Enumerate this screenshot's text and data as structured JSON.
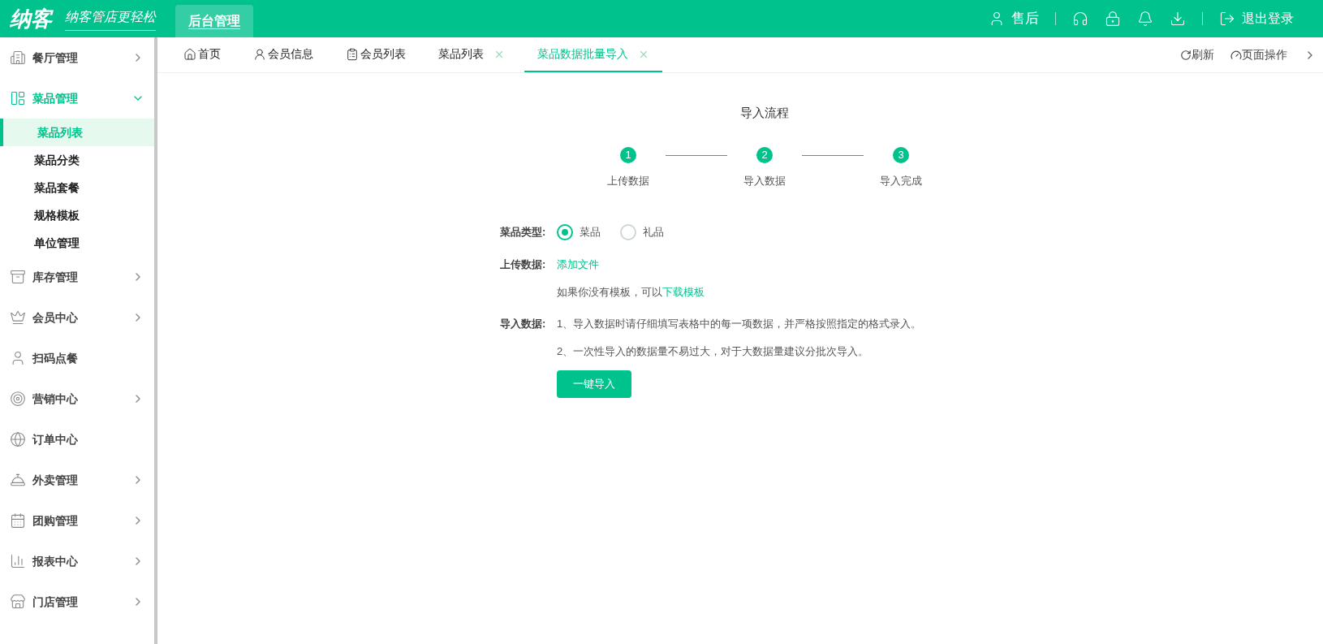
{
  "header": {
    "logo": "纳客",
    "slogan": "纳客管店更轻松",
    "nav_tab": "后台管理",
    "service": "售后",
    "logout": "退出登录"
  },
  "sidebar": {
    "items": [
      {
        "label": "餐厅管理",
        "expanded": false,
        "has_arrow": true
      },
      {
        "label": "菜品管理",
        "expanded": true,
        "has_arrow": true,
        "children": [
          {
            "label": "菜品列表",
            "selected": true
          },
          {
            "label": "菜品分类",
            "selected": false
          },
          {
            "label": "菜品套餐",
            "selected": false
          },
          {
            "label": "规格模板",
            "selected": false
          },
          {
            "label": "单位管理",
            "selected": false
          }
        ]
      },
      {
        "label": "库存管理",
        "expanded": false,
        "has_arrow": true
      },
      {
        "label": "会员中心",
        "expanded": false,
        "has_arrow": true
      },
      {
        "label": "扫码点餐",
        "expanded": false,
        "has_arrow": false
      },
      {
        "label": "营销中心",
        "expanded": false,
        "has_arrow": true
      },
      {
        "label": "订单中心",
        "expanded": false,
        "has_arrow": false
      },
      {
        "label": "外卖管理",
        "expanded": false,
        "has_arrow": true
      },
      {
        "label": "团购管理",
        "expanded": false,
        "has_arrow": true
      },
      {
        "label": "报表中心",
        "expanded": false,
        "has_arrow": true
      },
      {
        "label": "门店管理",
        "expanded": false,
        "has_arrow": true
      }
    ]
  },
  "tabs": [
    {
      "label": "首页",
      "selected": false,
      "closable": false
    },
    {
      "label": "会员信息",
      "selected": false,
      "closable": false
    },
    {
      "label": "会员列表",
      "selected": false,
      "closable": false
    },
    {
      "label": "菜品列表",
      "selected": false,
      "closable": true
    },
    {
      "label": "菜品数据批量导入",
      "selected": true,
      "closable": true
    }
  ],
  "tab_actions": {
    "refresh": "刷新",
    "page_ops": "页面操作"
  },
  "import": {
    "title": "导入流程",
    "steps": [
      {
        "number": "1",
        "label": "上传数据"
      },
      {
        "number": "2",
        "label": "导入数据"
      },
      {
        "number": "3",
        "label": "导入完成"
      }
    ],
    "type_label": "菜品类型:",
    "type_options": [
      {
        "label": "菜品",
        "selected": true
      },
      {
        "label": "礼品",
        "selected": false
      }
    ],
    "upload_label": "上传数据:",
    "add_file": "添加文件",
    "template_hint": "如果你没有模板，可以",
    "template_link": "下载模板",
    "notes_label": "导入数据:",
    "notes": [
      "1、导入数据时请仔细填写表格中的每一项数据，并严格按照指定的格式录入。",
      "2、一次性导入的数据量不易过大，对于大数据量建议分批次导入。"
    ],
    "submit": "一键导入"
  }
}
